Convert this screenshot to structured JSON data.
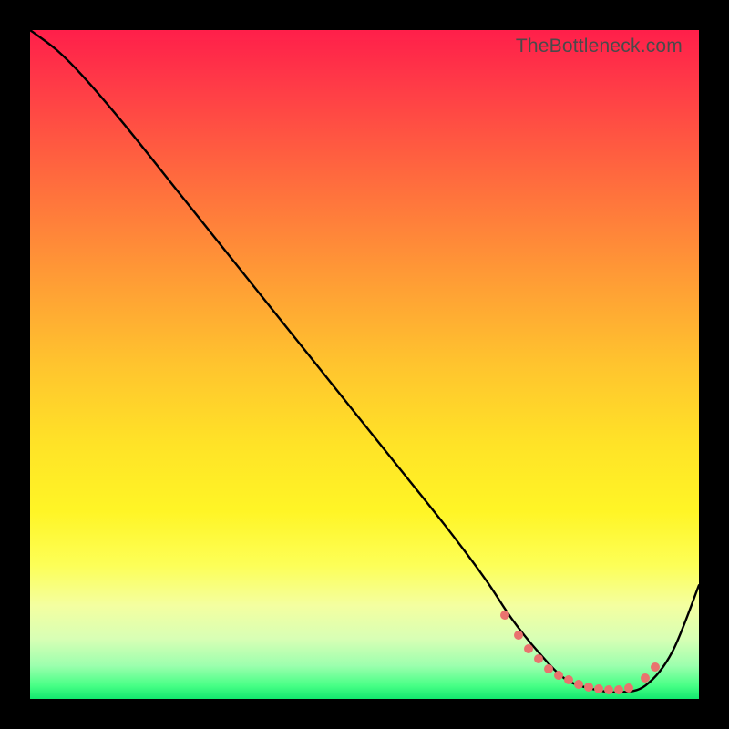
{
  "watermark": "TheBottleneck.com",
  "colors": {
    "line": "#000000",
    "marker": "#e9736e"
  },
  "chart_data": {
    "type": "line",
    "title": "",
    "xlabel": "",
    "ylabel": "",
    "xlim": [
      0,
      100
    ],
    "ylim": [
      0,
      100
    ],
    "series": [
      {
        "name": "curve",
        "x": [
          0,
          4,
          8,
          14,
          22,
          30,
          38,
          46,
          54,
          62,
          68,
          72,
          76,
          80,
          84,
          88,
          92,
          96,
          100
        ],
        "y": [
          100,
          97,
          93,
          86,
          76,
          66,
          56,
          46,
          36,
          26,
          18,
          12,
          7,
          3,
          1.5,
          1,
          2,
          7,
          17
        ]
      }
    ],
    "markers": {
      "name": "highlight-points",
      "x": [
        71,
        73,
        74.5,
        76,
        77.5,
        79,
        80.5,
        82,
        83.5,
        85,
        86.5,
        88,
        89.5,
        92,
        93.5
      ],
      "y": [
        12.5,
        9.5,
        7.5,
        6,
        4.5,
        3.5,
        2.8,
        2.2,
        1.8,
        1.5,
        1.3,
        1.3,
        1.6,
        3.2,
        4.8
      ]
    }
  }
}
